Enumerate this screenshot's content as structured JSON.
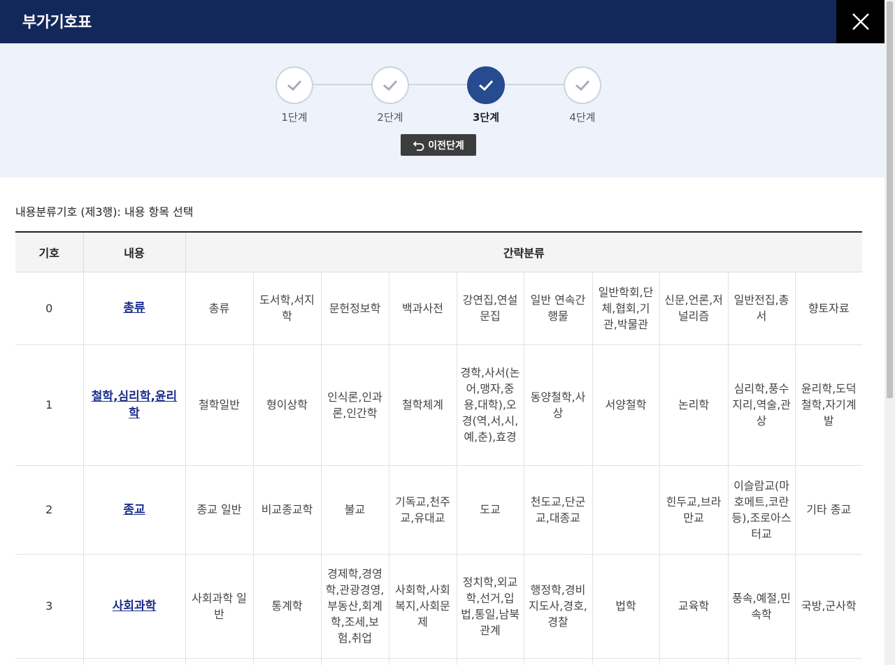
{
  "header": {
    "title": "부가기호표"
  },
  "steps": [
    {
      "label": "1단계",
      "active": false
    },
    {
      "label": "2단계",
      "active": false
    },
    {
      "label": "3단계",
      "active": true
    },
    {
      "label": "4단계",
      "active": false
    }
  ],
  "prev_button": {
    "label": "이전단계"
  },
  "section_title": "내용분류기호 (제3행): 내용 항목 선택",
  "table": {
    "headers": [
      "기호",
      "내용",
      "간략분류"
    ],
    "rows": [
      {
        "code": "0",
        "content": "총류",
        "cells": [
          "총류",
          "도서학,서지학",
          "문헌정보학",
          "백과사전",
          "강연집,연설문집",
          "일반 연속간행물",
          "일반학회,단체,협회,기관,박물관",
          "신문,언론,저널리즘",
          "일반전집,총서",
          "향토자료"
        ]
      },
      {
        "code": "1",
        "content": "철학,심리학,윤리학",
        "cells": [
          "철학일반",
          "형이상학",
          "인식론,인과론,인간학",
          "철학체계",
          "경학,사서(논어,맹자,중용,대학),오경(역,서,시,예,춘),효경",
          "동양철학,사상",
          "서양철학",
          "논리학",
          "심리학,풍수지리,역술,관상",
          "윤리학,도덕철학,자기계발"
        ]
      },
      {
        "code": "2",
        "content": "종교",
        "cells": [
          "종교 일반",
          "비교종교학",
          "불교",
          "기독교,천주교,유대교",
          "도교",
          "천도교,단군교,대종교",
          "",
          "힌두교,브라만교",
          "이슬람교(마호메트,코란등),조로아스터교",
          "기타 종교"
        ]
      },
      {
        "code": "3",
        "content": "사회과학",
        "cells": [
          "사회과학 일반",
          "통계학",
          "경제학,경영학,관광경영,부동산,회계학,조세,보험,취업",
          "사회학,사회복지,사회문제",
          "정치학,외교학,선거,입법,통일,남북관계",
          "행정학,경비지도사,경호,경찰",
          "법학",
          "교육학",
          "풍속,예절,민속학",
          "국방,군사학"
        ]
      }
    ]
  }
}
